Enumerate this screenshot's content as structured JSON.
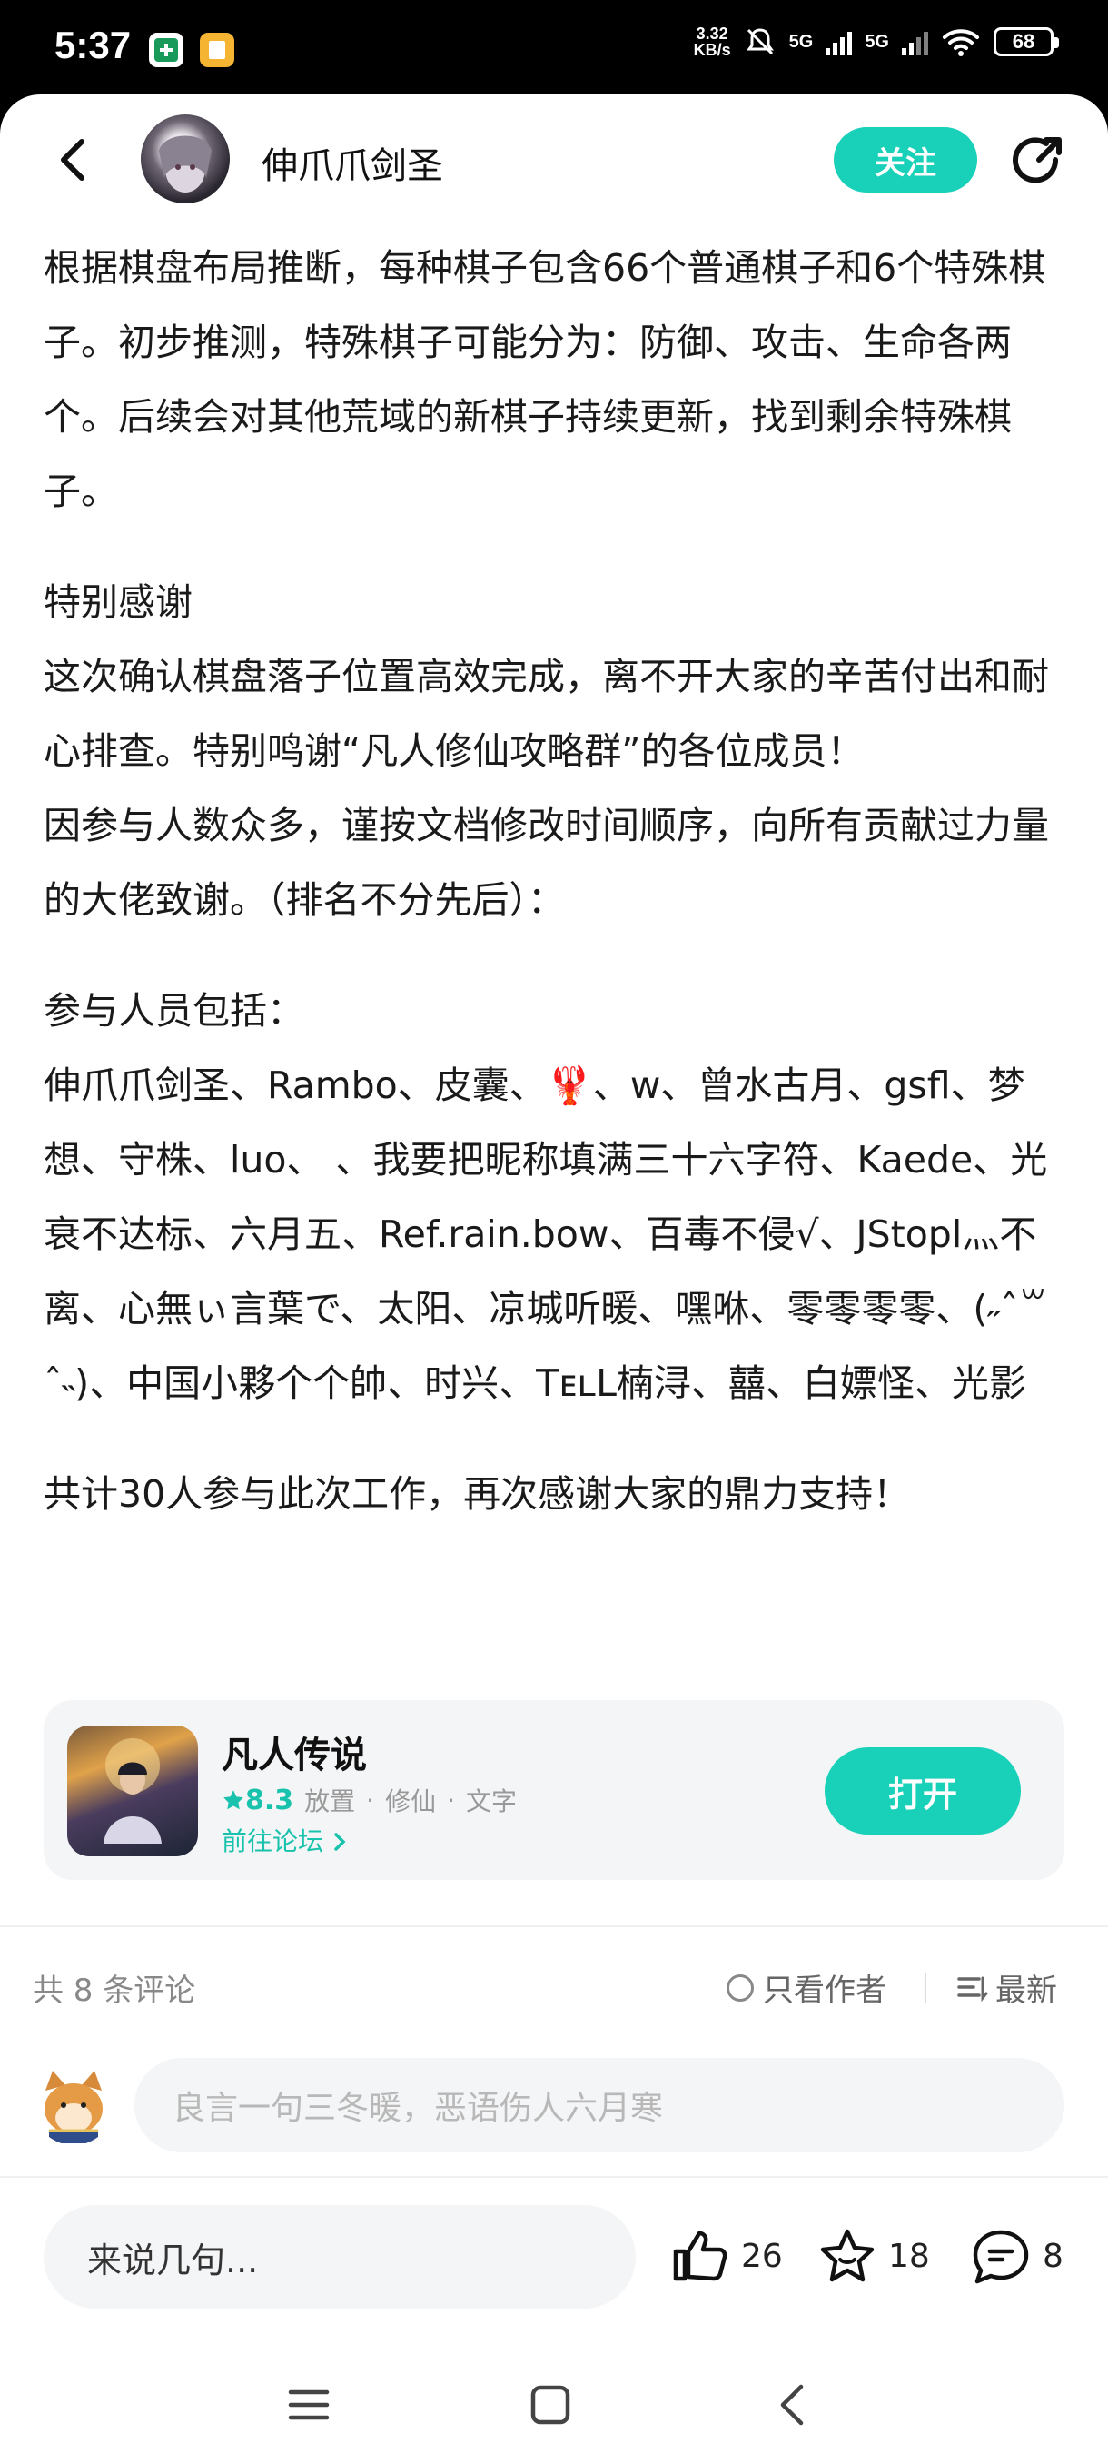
{
  "status_bar": {
    "time": "5:37",
    "net_speed_top": "3.32",
    "net_speed_bottom": "KB/s",
    "signal1": "5G",
    "signal2": "5G",
    "battery": "68"
  },
  "header": {
    "author": "伸爪爪剑圣",
    "follow_label": "关注"
  },
  "article": {
    "p1": "根据棋盘布局推断，每种棋子包含66个普通棋子和6个特殊棋子。初步推测，特殊棋子可能分为：防御、攻击、生命各两个。后续会对其他荒域的新棋子持续更新，找到剩余特殊棋子。",
    "heading_thanks": "特别感谢",
    "p2": "这次确认棋盘落子位置高效完成，离不开大家的辛苦付出和耐心排查。特别鸣谢“凡人修仙攻略群”的各位成员！",
    "p3": "因参与人数众多，谨按文档修改时间顺序，向所有贡献过力量的大佬致谢。（排名不分先后）：",
    "heading_participants": "参与人员包括：",
    "participants_before_emoji": "伸爪爪剑圣、Rambo、皮囊、",
    "emoji": "🦞",
    "participants_after_emoji": "、w、曾水古月、gsfl、梦想、守株、luo、 、我要把昵称填满三十六字符、Kaede、光衰不达标、六月五、Ref.rain.bow、百毒不侵√、JStopl灬不离、心無ぃ言葉で、太阳、凉城听暖、嘿咻、零零零零、(˶ˆ꒳ˆ˵)、中国小夥个个帥、时兴、TᴇʟL楠浔、囍、白嫖怪、光影",
    "p_total": "共计30人参与此次工作，再次感谢大家的鼎力支持！"
  },
  "app_card": {
    "name": "凡人传说",
    "rating": "8.3",
    "tags": [
      "放置",
      "修仙",
      "文字"
    ],
    "forum_link": "前往论坛",
    "open_label": "打开"
  },
  "comments": {
    "count_label": "共 8 条评论",
    "only_author_label": "只看作者",
    "sort_label": "最新",
    "input_placeholder": "良言一句三冬暖，恶语伤人六月寒"
  },
  "bottom_bar": {
    "say_placeholder": "来说几句...",
    "likes": "26",
    "favorites": "18",
    "comments": "8"
  },
  "colors": {
    "accent": "#19d0b8",
    "text": "#1a1a1a",
    "muted": "#888888",
    "input_bg": "#f4f5f6"
  },
  "icons": [
    "back-icon",
    "share-icon",
    "star-icon",
    "chevron-right-icon",
    "sort-icon",
    "thumbs-up-icon",
    "star-outline-icon",
    "comment-icon",
    "menu-icon",
    "home-square-icon",
    "back-nav-icon"
  ]
}
